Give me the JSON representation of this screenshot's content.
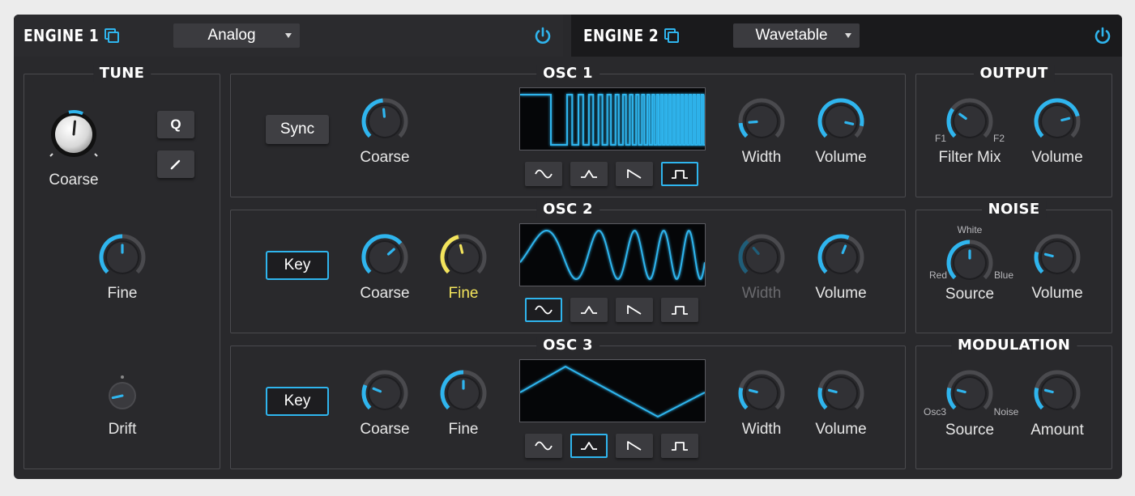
{
  "engine1": {
    "title": "ENGINE 1",
    "model": "Analog"
  },
  "engine2": {
    "title": "ENGINE 2",
    "model": "Wavetable"
  },
  "colors": {
    "accent": "#2fb5ee",
    "highlight": "#f3e45c",
    "panel": "#29292c"
  },
  "tune": {
    "title": "TUNE",
    "coarse": {
      "label": "Coarse",
      "value": 0.52
    },
    "q_label": "Q",
    "pencil_icon": "pencil-icon",
    "fine": {
      "label": "Fine",
      "value": 0.5
    },
    "drift": {
      "label": "Drift",
      "value": 0.12
    }
  },
  "osc1": {
    "title": "OSC 1",
    "button": "Sync",
    "coarse": {
      "label": "Coarse",
      "value": 0.48
    },
    "width": {
      "label": "Width",
      "value": 0.15
    },
    "volume": {
      "label": "Volume",
      "value": 0.88
    },
    "selected_wave": 3
  },
  "osc2": {
    "title": "OSC 2",
    "button": "Key",
    "coarse": {
      "label": "Coarse",
      "value": 0.68
    },
    "fine": {
      "label": "Fine",
      "value": 0.45
    },
    "width": {
      "label": "Width",
      "value": 0.35
    },
    "volume": {
      "label": "Volume",
      "value": 0.58
    },
    "selected_wave": 0
  },
  "osc3": {
    "title": "OSC 3",
    "button": "Key",
    "coarse": {
      "label": "Coarse",
      "value": 0.25
    },
    "fine": {
      "label": "Fine",
      "value": 0.5
    },
    "width": {
      "label": "Width",
      "value": 0.22
    },
    "volume": {
      "label": "Volume",
      "value": 0.22
    },
    "selected_wave": 1
  },
  "output": {
    "title": "OUTPUT",
    "filter_mix": {
      "label": "Filter Mix",
      "value": 0.3,
      "left": "F1",
      "right": "F2"
    },
    "volume": {
      "label": "Volume",
      "value": 0.78
    }
  },
  "noise": {
    "title": "NOISE",
    "source": {
      "label": "Source",
      "value": 0.5,
      "top": "White",
      "left": "Red",
      "right": "Blue"
    },
    "volume": {
      "label": "Volume",
      "value": 0.22
    }
  },
  "modulation": {
    "title": "MODULATION",
    "source": {
      "label": "Source",
      "value": 0.22,
      "left": "Osc3",
      "right": "Noise"
    },
    "amount": {
      "label": "Amount",
      "value": 0.22
    }
  }
}
